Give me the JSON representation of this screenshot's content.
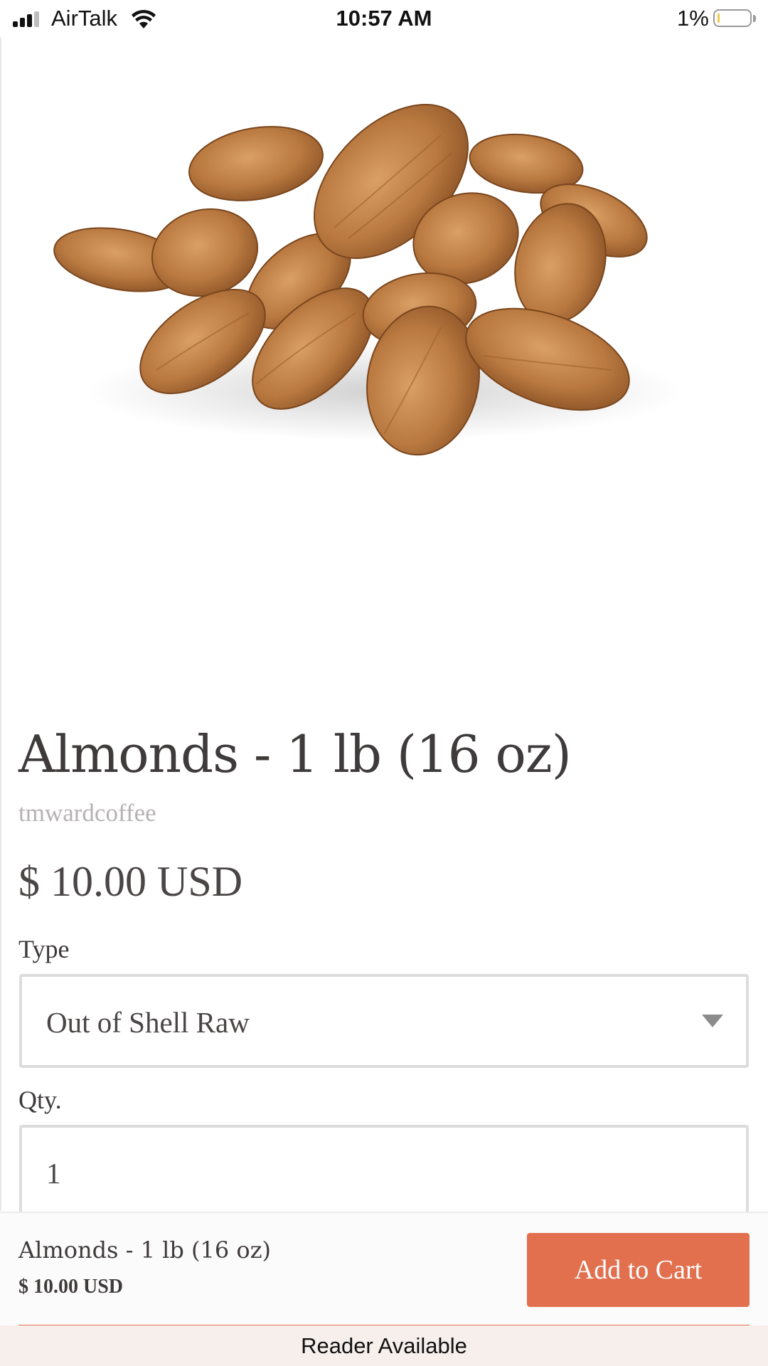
{
  "status_bar": {
    "carrier": "AirTalk",
    "time": "10:57 AM",
    "battery_percent": "1%",
    "battery_level": 0.01,
    "battery_fill_color": "#f2c94c",
    "icons": [
      "signal-icon",
      "wifi-icon",
      "battery-icon"
    ]
  },
  "product": {
    "title": "Almonds - 1 lb (16 oz)",
    "vendor": "tmwardcoffee",
    "price": "$ 10.00 USD",
    "type": {
      "label": "Type",
      "selected": "Out of Shell Raw"
    },
    "quantity": {
      "label": "Qty.",
      "value": "1"
    }
  },
  "cart_bar": {
    "title": "Almonds - 1 lb (16 oz)",
    "price": "$ 10.00 USD",
    "button_label": "Add to Cart",
    "accent_color": "#e2704f"
  },
  "reader": {
    "label": "Reader Available"
  }
}
